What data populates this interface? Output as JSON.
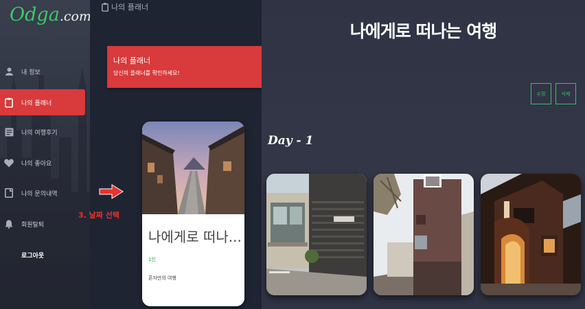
{
  "logo": {
    "brand": "Odga",
    "tld": ".com"
  },
  "sidebar": {
    "items": [
      {
        "label": "내 정보",
        "icon": "user-icon"
      },
      {
        "label": "나의 플래너",
        "icon": "clipboard-icon",
        "active": true
      },
      {
        "label": "나의 여행후기",
        "icon": "newspaper-icon"
      },
      {
        "label": "나의 좋아요",
        "icon": "heart-icon"
      },
      {
        "label": "나의 문의내역",
        "icon": "document-icon"
      },
      {
        "label": "회원탈퇴",
        "icon": "bell-icon"
      },
      {
        "label": "로그아웃"
      }
    ]
  },
  "middle": {
    "header_title": "나의 플래너",
    "header_icon": "clipboard-icon",
    "alert": {
      "title": "나의 플래너",
      "message": "당신의 플래너를 확인하세요!"
    },
    "card": {
      "title": "나에게로 떠나...",
      "people": "1인",
      "description": "혼자만의 여행"
    }
  },
  "annotation": {
    "step_label": "3. 날짜 선택",
    "color": "#e8332f"
  },
  "main": {
    "title": "나에게로 떠나는 여행",
    "edit_label": "수정",
    "delete_label": "삭제",
    "day_label": "Day - 1"
  },
  "colors": {
    "accent_red": "#d93a3b",
    "accent_green": "#3cbf6a",
    "sidebar_bg": "#2e323f",
    "main_bg": "#333747"
  }
}
